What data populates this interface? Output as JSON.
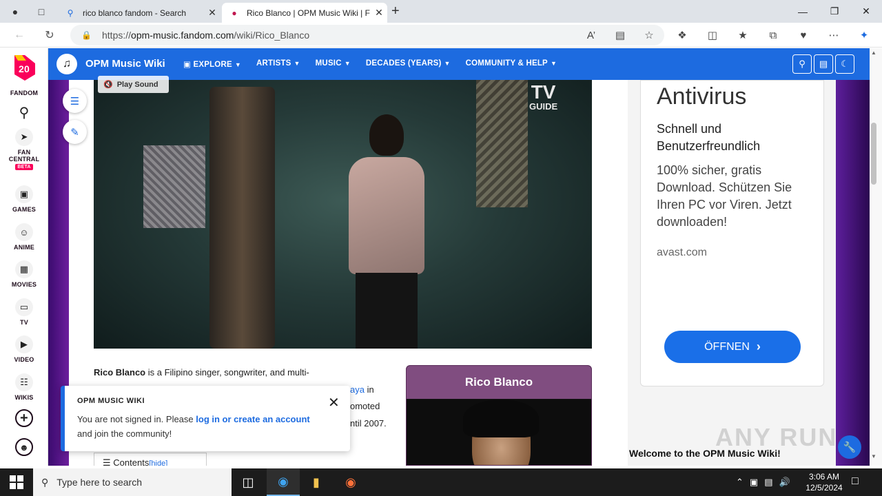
{
  "browser": {
    "tabs": [
      {
        "title": "rico blanco fandom - Search",
        "icon": "search-icon"
      },
      {
        "title": "Rico Blanco | OPM Music Wiki | F",
        "icon": "fandom-favicon"
      }
    ],
    "url_prefix": "https://",
    "url_host": "opm-music.fandom.com",
    "url_path": "/wiki/Rico_Blanco"
  },
  "fandom_sidebar": {
    "logo_number": "20",
    "logo_label": "FANDOM",
    "items": [
      {
        "label": "FAN CENTRAL",
        "badge": "BETA",
        "icon": "rocket-icon"
      },
      {
        "label": "GAMES",
        "icon": "gamepad-icon"
      },
      {
        "label": "ANIME",
        "icon": "anime-icon"
      },
      {
        "label": "MOVIES",
        "icon": "movie-icon"
      },
      {
        "label": "TV",
        "icon": "tv-icon"
      },
      {
        "label": "VIDEO",
        "icon": "video-icon"
      },
      {
        "label": "WIKIS",
        "icon": "book-icon"
      }
    ]
  },
  "wiki_header": {
    "name": "OPM Music Wiki",
    "nav": [
      {
        "label": "EXPLORE"
      },
      {
        "label": "ARTISTS"
      },
      {
        "label": "MUSIC"
      },
      {
        "label": "DECADES (YEARS)"
      },
      {
        "label": "COMMUNITY & HELP"
      }
    ]
  },
  "video": {
    "play_sound": "Play Sound",
    "watermark_top": "TV",
    "watermark_bottom": "GUIDE"
  },
  "article": {
    "subject": "Rico Blanco",
    "line1_rest": "is a Filipino singer, songwriter, and multi-",
    "line2_link": "aya",
    "line2_rest": "in",
    "line3": "omoted",
    "line4": "ntil 2007.",
    "toc_label": "Contents",
    "toc_hide": "hide"
  },
  "infobox": {
    "title": "Rico Blanco"
  },
  "toast": {
    "title": "OPM MUSIC WIKI",
    "msg_before": "You are not signed in. Please",
    "msg_link": "log in or create an account",
    "msg_after": "and join the community!"
  },
  "ad": {
    "headline": "Antivirus",
    "subheadline": "Schnell und Benutzerfreundlich",
    "description": "100% sicher, gratis Download. Schützen Sie Ihren PC vor Viren. Jetzt downloaden!",
    "domain": "avast.com",
    "button": "ÖFFNEN"
  },
  "rail": {
    "welcome": "Welcome to the OPM Music Wiki!",
    "watermark": "ANY RUN"
  },
  "taskbar": {
    "search_placeholder": "Type here to search",
    "time": "3:06 AM",
    "date": "12/5/2024"
  },
  "colors": {
    "wiki_header": "#1d6be0",
    "infobox_title": "#804d80",
    "fandom_pink": "#fa005a"
  }
}
